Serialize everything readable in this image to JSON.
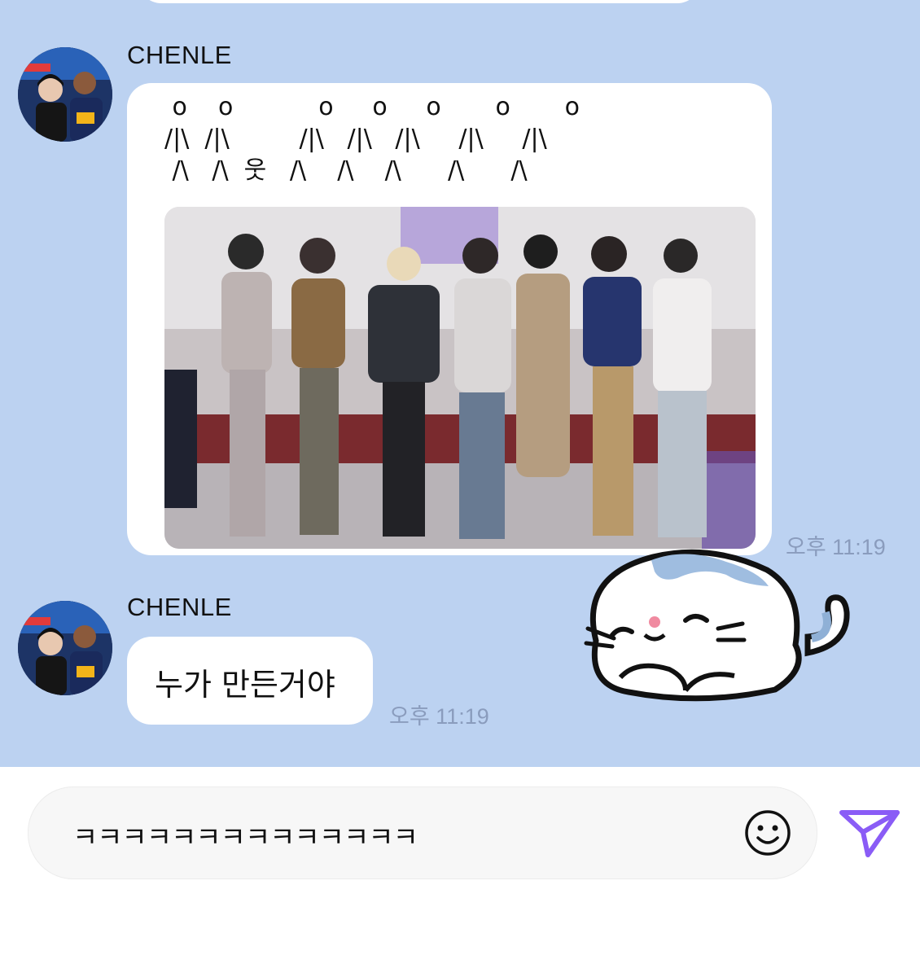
{
  "messages": [
    {
      "sender": "CHENLE",
      "ascii_art": " o    o           o     o     o       o       o\n/|\\  /|\\         /|\\   /|\\   /|\\     /|\\     /|\\\n /\\   /\\  웃   /\\    /\\    /\\      /\\      /\\",
      "photo": "group photo of seven people posing in front of a stage backdrop",
      "time": "오후 11:19"
    },
    {
      "sender": "CHENLE",
      "text": "누가 만든거야",
      "time": "오후 11:19"
    }
  ],
  "sticker": "sleeping-cat-sticker",
  "input": {
    "value": "ㅋㅋㅋㅋㅋㅋㅋㅋㅋㅋㅋㅋㅋㅋ"
  },
  "icons": {
    "emoji": "smiley-face-icon",
    "send": "paper-plane-send-icon"
  },
  "colors": {
    "chat_background": "#bcd2f1",
    "bubble": "#ffffff",
    "send_accent": "#8a5cf6",
    "timestamp": "#8a9cbd"
  }
}
